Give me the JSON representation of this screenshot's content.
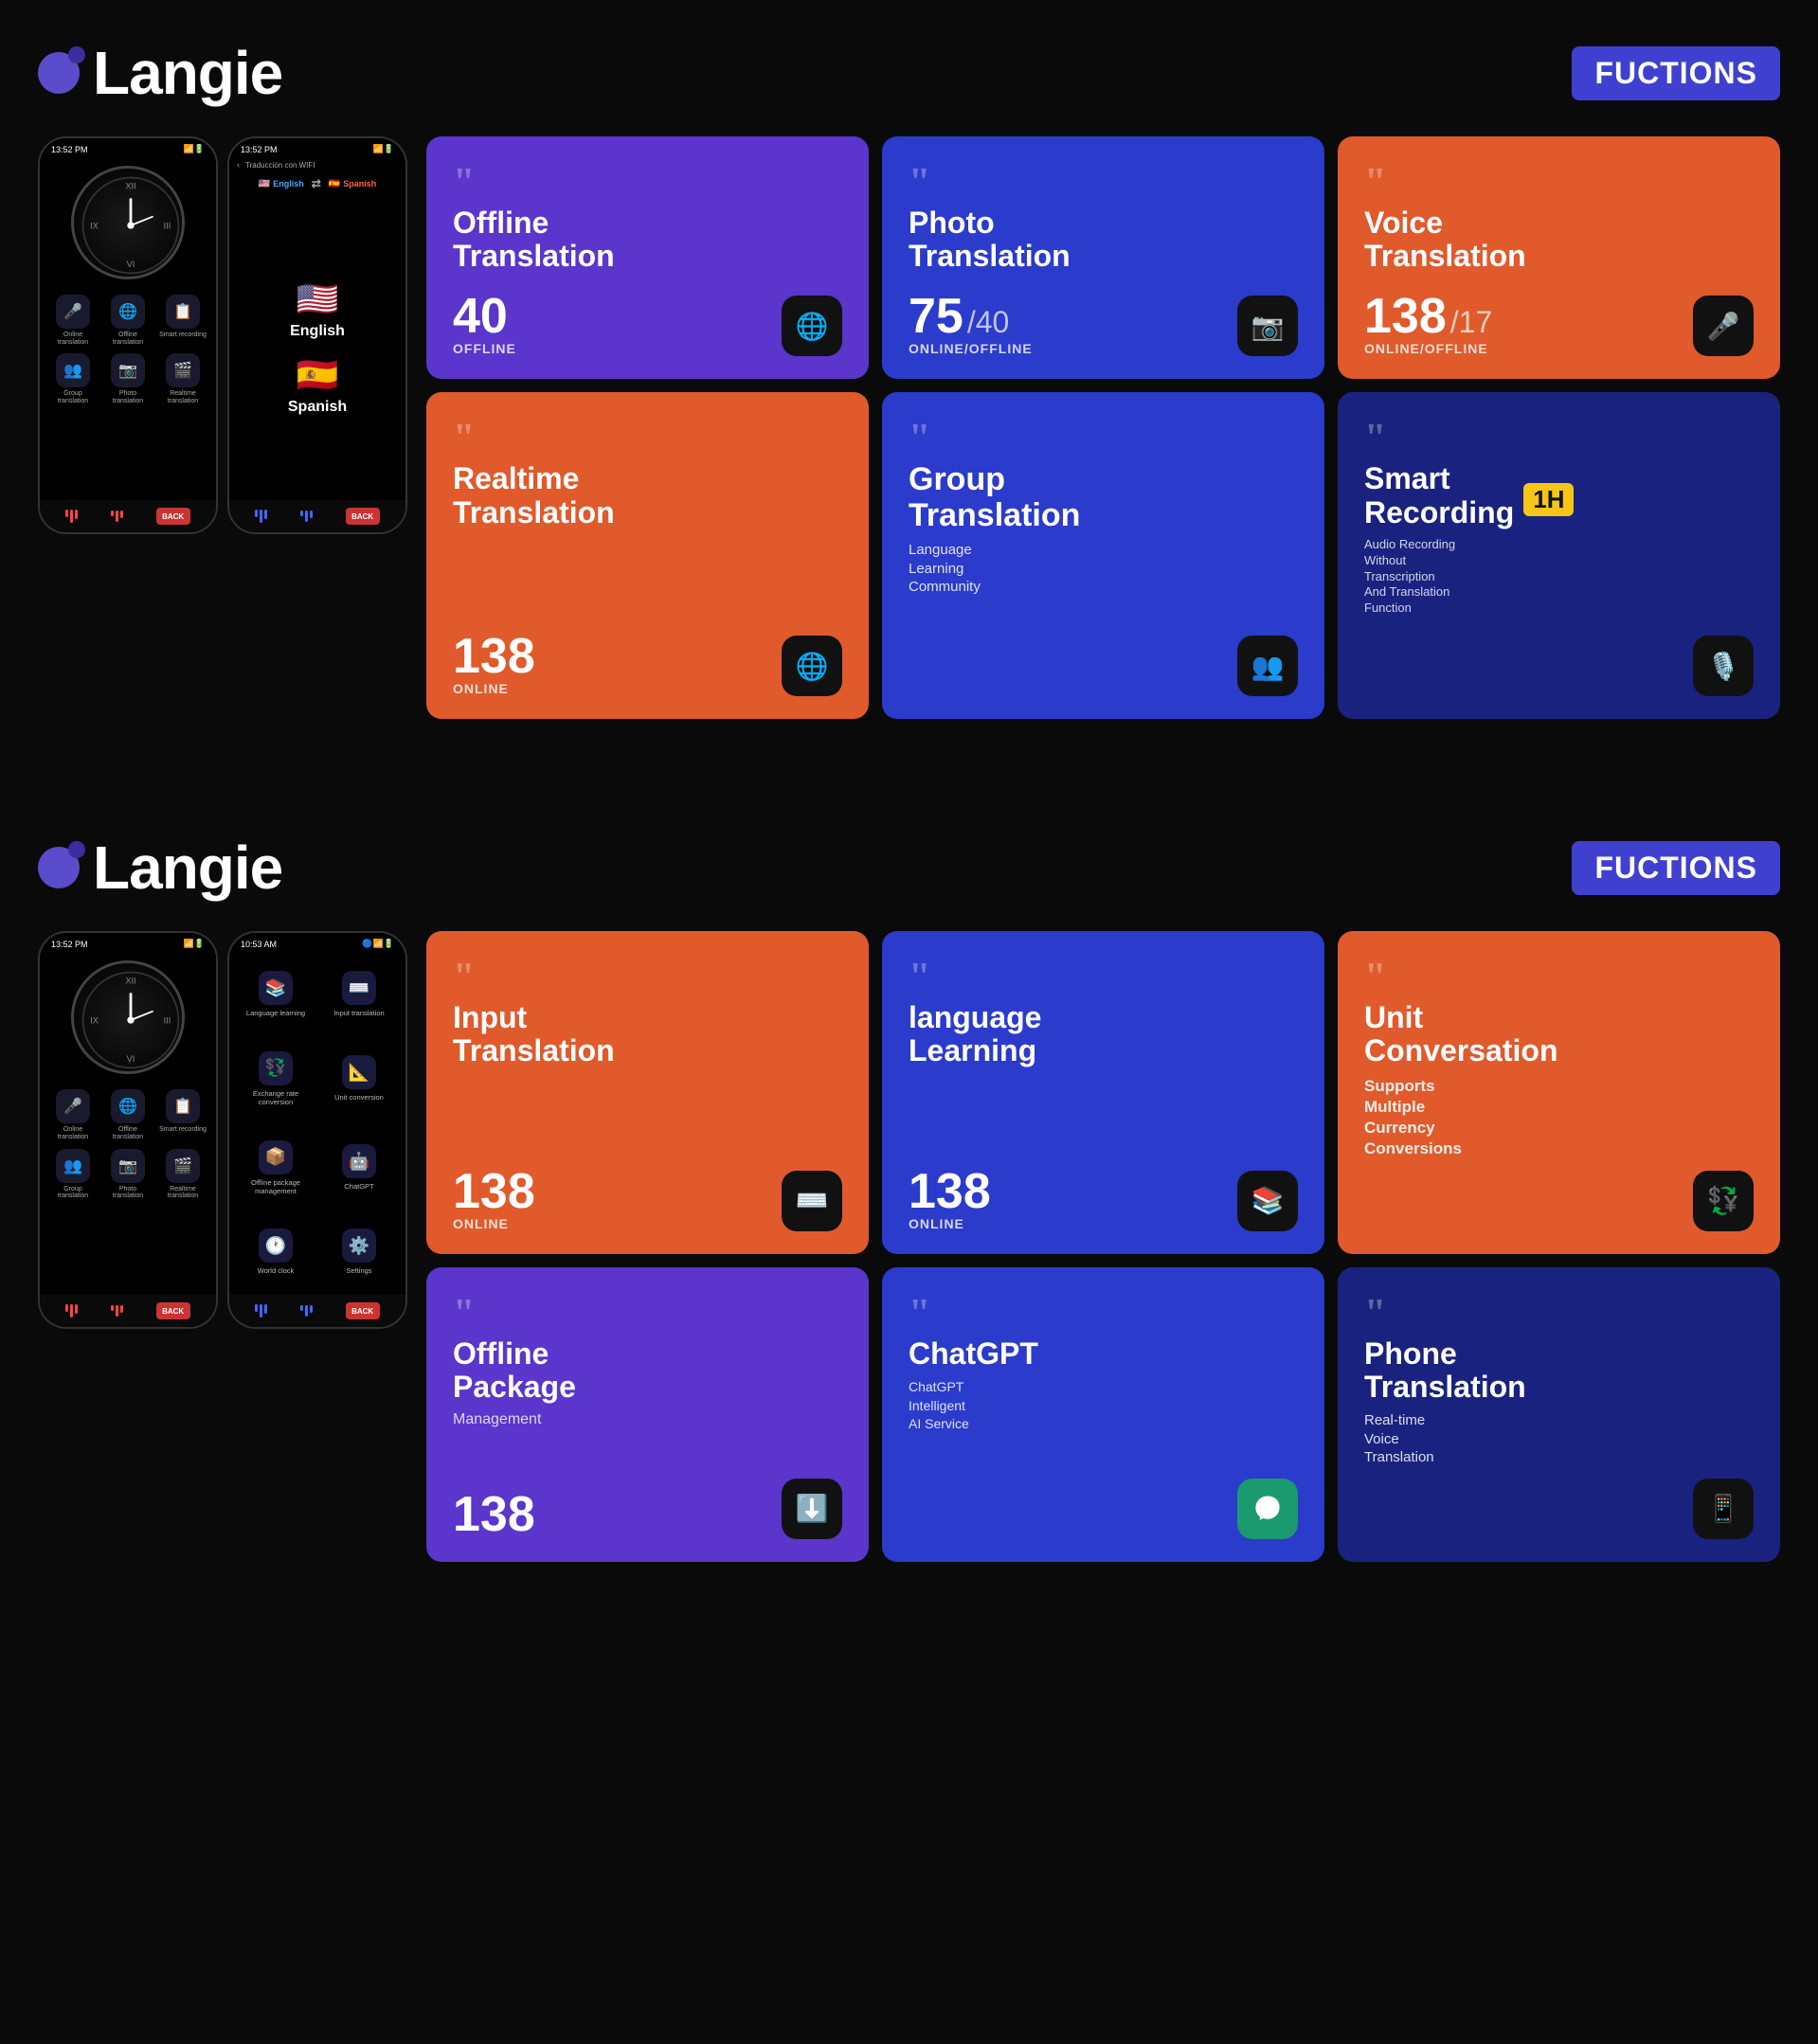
{
  "sections": [
    {
      "id": "section1",
      "logo": "Langie",
      "functions_label": "FUCTIONS",
      "phone1": {
        "time": "13:52 PM",
        "icons": [
          {
            "label": "Online translation",
            "emoji": "🎤"
          },
          {
            "label": "Offline translation",
            "emoji": "🌐"
          },
          {
            "label": "Smart recording",
            "emoji": "📋"
          },
          {
            "label": "Group translation",
            "emoji": "👥"
          },
          {
            "label": "Photo translation",
            "emoji": "📷"
          },
          {
            "label": "Realtime translation",
            "emoji": "🎬"
          }
        ]
      },
      "phone2": {
        "type": "translation",
        "back_label": "Traducción con WIFI",
        "from_lang": "English",
        "from_flag": "🇺🇸",
        "to_lang": "Spanish",
        "to_flag": "🇪🇸"
      },
      "cards": [
        {
          "id": "offline-translation",
          "color": "purple",
          "title": "Offline Translation",
          "count": "40",
          "status": "OFFLINE",
          "icon": "🌐",
          "slash_count": null
        },
        {
          "id": "photo-translation",
          "color": "blue",
          "title": "Photo Translation",
          "count": "75",
          "slash_count": "40",
          "status": "ONLINE/OFFLINE",
          "icon": "📷"
        },
        {
          "id": "voice-translation",
          "color": "orange",
          "title": "Voice Translation",
          "count": "138",
          "slash_count": "17",
          "status": "ONLINE/OFFLINE",
          "icon": "🎤"
        },
        {
          "id": "realtime-translation",
          "color": "orange",
          "title": "Realtime Translation",
          "count": "138",
          "status": "ONLINE",
          "icon": "🌐",
          "slash_count": null
        },
        {
          "id": "group-translation",
          "color": "blue",
          "title": "Group Translation",
          "desc": "Language Learning Community",
          "icon": "👥"
        },
        {
          "id": "smart-recording",
          "color": "dark-blue",
          "title": "Smart Recording",
          "badge": "1H",
          "desc": "Audio Recording Without Transcription And Translation Function",
          "icon": "🎙️"
        }
      ]
    },
    {
      "id": "section2",
      "logo": "Langie",
      "functions_label": "FUCTIONS",
      "phone1": {
        "time": "13:52 PM"
      },
      "phone2": {
        "type": "menu",
        "time": "10:53 AM",
        "items": [
          {
            "label": "Language learning",
            "emoji": "📚"
          },
          {
            "label": "Input translation",
            "emoji": "⌨️"
          },
          {
            "label": "Exchange rate conversion",
            "emoji": "💱"
          },
          {
            "label": "Unit conversion",
            "emoji": "📐"
          },
          {
            "label": "Offline package management",
            "emoji": "📦"
          },
          {
            "label": "ChatGPT",
            "emoji": "🤖"
          },
          {
            "label": "World clock",
            "emoji": "🕐"
          },
          {
            "label": "Settings",
            "emoji": "⚙️"
          }
        ]
      },
      "cards": [
        {
          "id": "input-translation",
          "color": "orange",
          "title": "Input Translation",
          "count": "138",
          "status": "ONLINE",
          "icon": "⌨️",
          "slash_count": null
        },
        {
          "id": "language-learning",
          "color": "blue",
          "title": "language Learning",
          "count": "138",
          "status": "ONLINE",
          "icon": "📚",
          "slash_count": null
        },
        {
          "id": "unit-conversation",
          "color": "orange",
          "title": "Unit Conversation",
          "desc": "Supports Multiple Currency Conversions",
          "icon": "💱"
        },
        {
          "id": "offline-package",
          "color": "purple",
          "title": "Offline Package",
          "subtitle": "Management",
          "count": "138",
          "icon": "⬇️",
          "slash_count": null
        },
        {
          "id": "chatgpt",
          "color": "blue",
          "title": "ChatGPT",
          "desc": "ChatGPT Intelligent AI Service",
          "icon": "🤖"
        },
        {
          "id": "phone-translation",
          "color": "dark-blue",
          "title": "Phone Translation",
          "desc": "Real-time Voice Translation",
          "icon": "📱"
        }
      ]
    }
  ]
}
